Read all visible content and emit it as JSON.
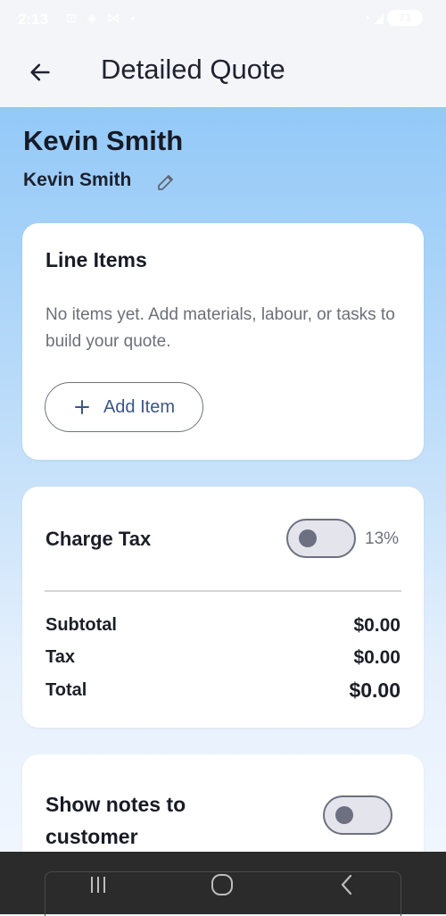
{
  "status_bar": {
    "time": "2:13",
    "left_icons": "⊡ ◈ ⋈ •",
    "right_icons": "◔ ◢",
    "battery": "73"
  },
  "app_bar": {
    "back_icon": "arrow-back-icon",
    "title": "Detailed Quote"
  },
  "client": {
    "name": "Kevin Smith",
    "subtitle": "Kevin Smith",
    "edit_icon": "pencil-icon"
  },
  "line_items": {
    "title": "Line Items",
    "empty_text": "No items yet. Add materials, labour, or tasks to build your quote.",
    "add_button_icon": "plus-icon",
    "add_button_label": "Add Item"
  },
  "tax": {
    "label": "Charge Tax",
    "enabled": false,
    "rate": "13%"
  },
  "totals": {
    "subtotal_label": "Subtotal",
    "subtotal_value": "$0.00",
    "tax_label": "Tax",
    "tax_value": "$0.00",
    "total_label": "Total",
    "total_value": "$0.00"
  },
  "notes": {
    "label": "Show notes to customer",
    "enabled": false
  },
  "nav": {
    "recent_icon": "recent-apps-icon",
    "home_icon": "home-icon",
    "back_icon": "back-icon"
  },
  "colors": {
    "gradient_top": "#93c9f8",
    "gradient_bottom": "#f1f6fe",
    "accent": "#3c5687",
    "nav_bar": "#2b2b2c"
  }
}
